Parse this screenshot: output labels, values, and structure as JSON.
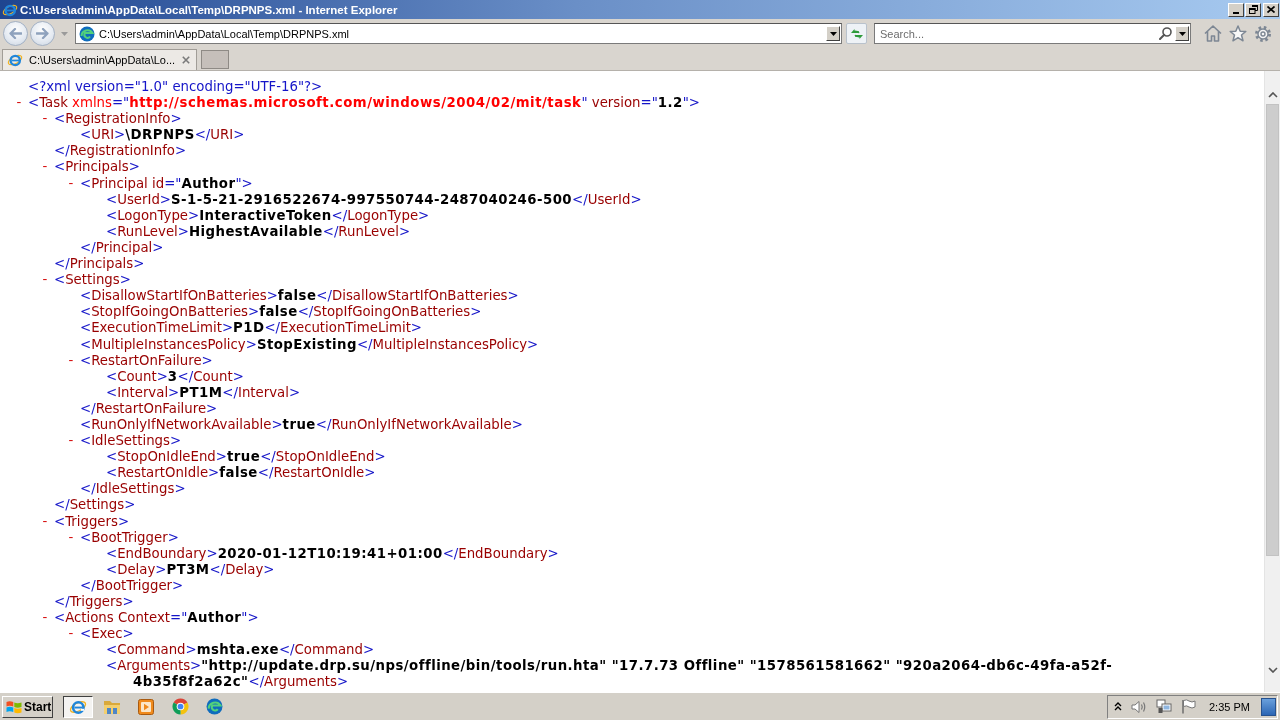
{
  "window": {
    "title": "C:\\Users\\admin\\AppData\\Local\\Temp\\DRPNPS.xml - Internet Explorer"
  },
  "navigation": {
    "address": "C:\\Users\\admin\\AppData\\Local\\Temp\\DRPNPS.xml",
    "search": {
      "placeholder": "Search..."
    }
  },
  "tabs": [
    {
      "label": "C:\\Users\\admin\\AppData\\Lo...",
      "selected": true
    }
  ],
  "document": {
    "declaration": "<?xml version=\"1.0\" encoding=\"UTF-16\"?>",
    "nodes": [
      {
        "toggle": "-",
        "open": "<Task",
        "attributes": [
          {
            "text": " xmlns=\"http://schemas.microsoft.com/windows/2004/02/mit/task\"",
            "kind": "namespace"
          },
          {
            "text": " version=\"1.2\"",
            "kind": "attribute"
          }
        ],
        "open_end": ">",
        "children": [
          {
            "toggle": "-",
            "open": "<RegistrationInfo>",
            "children": [
              {
                "open": "<URI>",
                "text": "\\DRPNPS",
                "close": "</URI>"
              }
            ],
            "close": "</RegistrationInfo>"
          },
          {
            "toggle": "-",
            "open": "<Principals>",
            "children": [
              {
                "toggle": "-",
                "open": "<Principal",
                "attributes": [
                  {
                    "text": " id=\"Author\"",
                    "kind": "attribute"
                  }
                ],
                "open_end": ">",
                "children": [
                  {
                    "open": "<UserId>",
                    "text": "S-1-5-21-2916522674-997550744-2487040246-500",
                    "close": "</UserId>"
                  },
                  {
                    "open": "<LogonType>",
                    "text": "InteractiveToken",
                    "close": "</LogonType>"
                  },
                  {
                    "open": "<RunLevel>",
                    "text": "HighestAvailable",
                    "close": "</RunLevel>"
                  }
                ],
                "close": "</Principal>"
              }
            ],
            "close": "</Principals>"
          },
          {
            "toggle": "-",
            "open": "<Settings>",
            "children": [
              {
                "open": "<DisallowStartIfOnBatteries>",
                "text": "false",
                "close": "</DisallowStartIfOnBatteries>"
              },
              {
                "open": "<StopIfGoingOnBatteries>",
                "text": "false",
                "close": "</StopIfGoingOnBatteries>"
              },
              {
                "open": "<ExecutionTimeLimit>",
                "text": "P1D",
                "close": "</ExecutionTimeLimit>"
              },
              {
                "open": "<MultipleInstancesPolicy>",
                "text": "StopExisting",
                "close": "</MultipleInstancesPolicy>"
              },
              {
                "toggle": "-",
                "open": "<RestartOnFailure>",
                "children": [
                  {
                    "open": "<Count>",
                    "text": "3",
                    "close": "</Count>"
                  },
                  {
                    "open": "<Interval>",
                    "text": "PT1M",
                    "close": "</Interval>"
                  }
                ],
                "close": "</RestartOnFailure>"
              },
              {
                "open": "<RunOnlyIfNetworkAvailable>",
                "text": "true",
                "close": "</RunOnlyIfNetworkAvailable>"
              },
              {
                "toggle": "-",
                "open": "<IdleSettings>",
                "children": [
                  {
                    "open": "<StopOnIdleEnd>",
                    "text": "true",
                    "close": "</StopOnIdleEnd>"
                  },
                  {
                    "open": "<RestartOnIdle>",
                    "text": "false",
                    "close": "</RestartOnIdle>"
                  }
                ],
                "close": "</IdleSettings>"
              }
            ],
            "close": "</Settings>"
          },
          {
            "toggle": "-",
            "open": "<Triggers>",
            "children": [
              {
                "toggle": "-",
                "open": "<BootTrigger>",
                "children": [
                  {
                    "open": "<EndBoundary>",
                    "text": "2020-01-12T10:19:41+01:00",
                    "close": "</EndBoundary>"
                  },
                  {
                    "open": "<Delay>",
                    "text": "PT3M",
                    "close": "</Delay>"
                  }
                ],
                "close": "</BootTrigger>"
              }
            ],
            "close": "</Triggers>"
          },
          {
            "toggle": "-",
            "open": "<Actions",
            "attributes": [
              {
                "text": " Context=\"Author\"",
                "kind": "attribute"
              }
            ],
            "open_end": ">",
            "children": [
              {
                "toggle": "-",
                "open": "<Exec>",
                "children": [
                  {
                    "open": "<Command>",
                    "text": "mshta.exe",
                    "close": "</Command>"
                  },
                  {
                    "open": "<Arguments>",
                    "text": "\"http://update.drp.su/nps/offline/bin/tools/run.hta\" \"17.7.73 Offline\" \"1578561581662\" \"920a2064-db6c-49fa-a52f-4b35f8f2a62c\"",
                    "close": "</Arguments>"
                  }
                ]
              }
            ]
          }
        ]
      }
    ]
  },
  "taskbar": {
    "start": "Start",
    "apps": [
      {
        "kind": "browser-e",
        "selected": true
      },
      {
        "kind": "folder",
        "selected": false
      },
      {
        "kind": "media-player",
        "selected": false
      },
      {
        "kind": "browser-ring",
        "selected": false
      },
      {
        "kind": "browser-swirl",
        "selected": false
      }
    ],
    "clock": "2:35 PM"
  }
}
